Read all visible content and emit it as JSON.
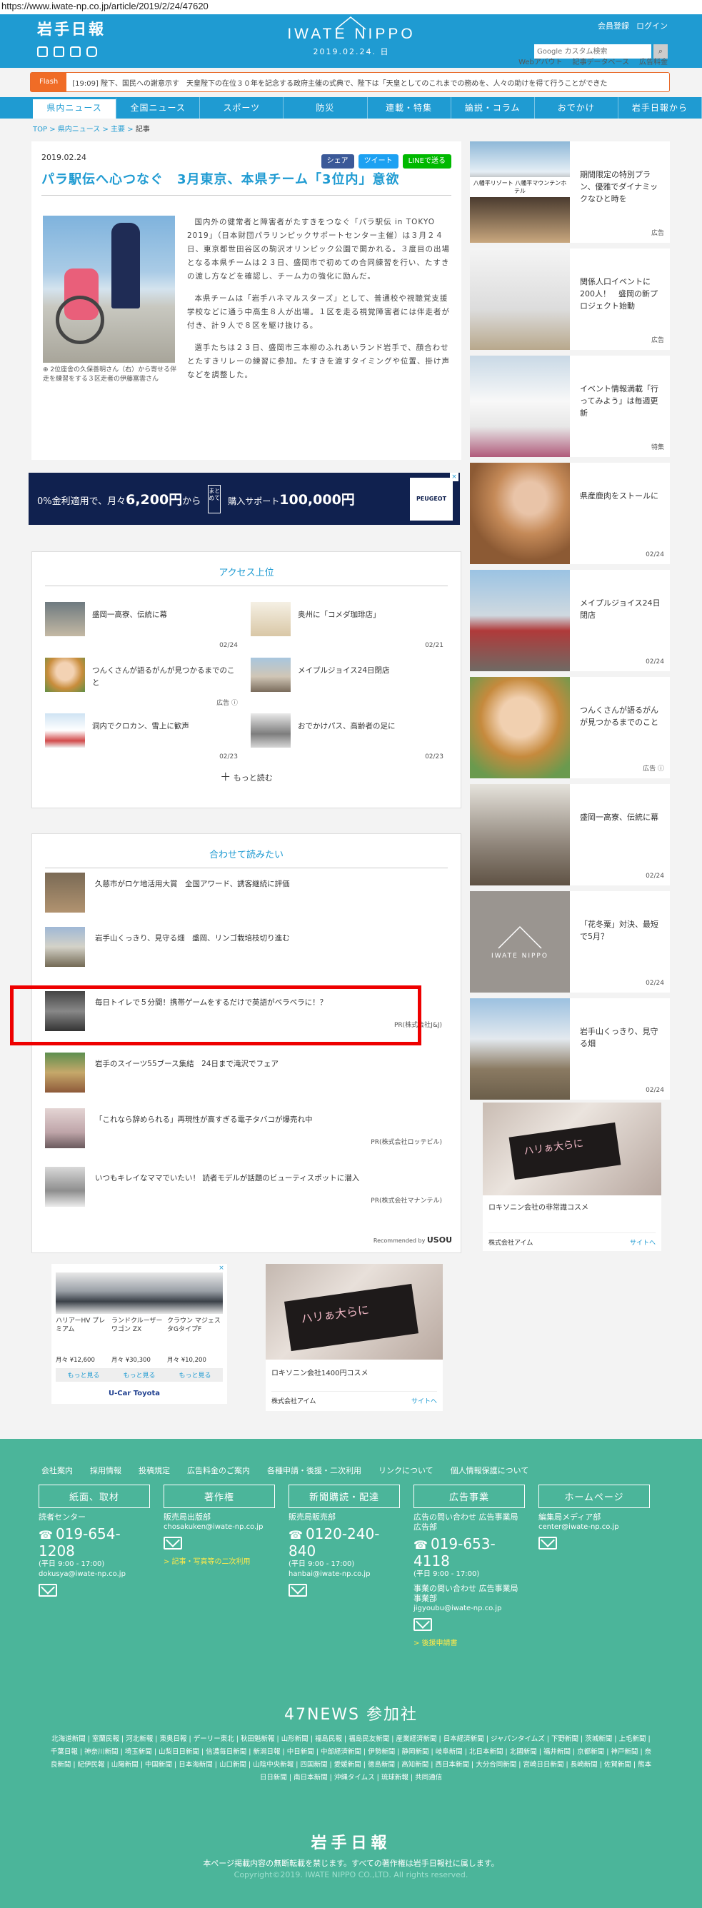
{
  "url": "https://www.iwate-np.co.jp/article/2019/2/24/47620",
  "header": {
    "brand": "岩手日報",
    "logo": "IWATE NIPPO",
    "date": "2019.02.24. 日",
    "account": [
      "会員登録",
      "ログイン"
    ],
    "search_placeholder": "Google カスタム検索",
    "subnav": [
      "Webアバウト",
      "記事データベース",
      "広告料金"
    ]
  },
  "flash": {
    "tag": "Flash",
    "time": "[19:09]",
    "headline": "陛下、国民への謝意示す",
    "text": "天皇陛下の在位３０年を記念する政府主催の式典で、陛下は「天皇としてのこれまでの務めを、人々の助けを得て行うことができた"
  },
  "nav": [
    "県内ニュース",
    "全国ニュース",
    "スポーツ",
    "防災",
    "連載・特集",
    "論説・コラム",
    "おでかけ",
    "岩手日報から"
  ],
  "breadcrumb": {
    "top": "TOP",
    "sep": ">",
    "cat": "県内ニュース",
    "sub": "主要",
    "cur": "記事"
  },
  "article": {
    "date": "2019.02.24",
    "share": [
      "シェア",
      "ツイート",
      "LINEで送る"
    ],
    "title": "パラ駅伝へ心つなぐ　3月東京、本県チーム「3位内」意欲",
    "caption": "2位座舎の久保善明さん（右）から寄せる伴走を練習をする３区走者の伊藤富雲さん",
    "paragraphs": [
      "国内外の健常者と障害者がたすきをつなぐ「パラ駅伝 in TOKYO 2019」（日本財団パラリンピックサポートセンター主催）は３月２４日、東京都世田谷区の駒沢オリンピック公園で開かれる。３度目の出場となる本県チームは２３日、盛岡市で初めての合同練習を行い、たすきの渡し方などを確認し、チーム力の強化に励んだ。",
      "本県チームは「岩手ハネマルスターズ」として、普通校や視聴覚支援学校などに通う中高生８人が出場。１区を走る視覚障害者には伴走者が付き、計９人で８区を駆け抜ける。",
      "選手たちは２３日、盛岡市三本柳のふれあいランド岩手で、顔合わせとたすきリレーの練習に参加。たすきを渡すタイミングや位置、掛け声などを調整した。"
    ]
  },
  "banner1": {
    "a": "0%金利適用で、月々",
    "b": "6,200円",
    "c": "から",
    "box": "購入サポート",
    "d": "100,000円",
    "brand": "PEUGEOT"
  },
  "ranking": {
    "title": "アクセス上位",
    "items": [
      {
        "text": "盛岡一高寮、伝統に幕",
        "date": "02/24"
      },
      {
        "text": "奥州に「コメダ珈琲店」",
        "date": "02/21"
      },
      {
        "text": "つんくさんが語るがんが見つかるまでのこと",
        "date": "広告 ⓘ"
      },
      {
        "text": "メイプルジョイス24日閉店",
        "date": ""
      },
      {
        "text": "洞内でクロカン、雪上に歓声",
        "date": "02/23"
      },
      {
        "text": "おでかけパス、高齢者の足に",
        "date": "02/23"
      }
    ],
    "more": "もっと読む"
  },
  "related": {
    "title": "合わせて読みたい",
    "items": [
      {
        "text": "久慈市がロケ地活用大賞　全国アワード、誘客継続に評価",
        "pr": ""
      },
      {
        "text": "岩手山くっきり、見守る畑　盛岡、リンゴ栽培枝切り進む",
        "pr": ""
      },
      {
        "text": "毎日トイレで５分間！携帯ゲームをするだけで英語がペラペラに！？",
        "pr": "PR(株式会社J&J)"
      },
      {
        "text": "岩手のスイーツ55ブース集結　24日まで滝沢でフェア",
        "pr": ""
      },
      {
        "text": "「これなら辞められる」再現性が高すぎる電子タバコが爆売れ中",
        "pr": "PR(株式会社ロッテビル)"
      },
      {
        "text": "いつもキレイなママでいたい！ 読者モデルが話題のビューティスポットに潜入",
        "pr": "PR(株式会社マナンテル)"
      }
    ],
    "rec": "Recommended by",
    "rec_brand": "USOU"
  },
  "ad_cars": {
    "items": [
      {
        "name": "ハリアーHV プレミアム",
        "price": "月々 ¥12,600"
      },
      {
        "name": "ランドクルーザーワゴン ZX",
        "price": "月々 ¥30,300"
      },
      {
        "name": "クラウン マジェスタGタイプF",
        "price": "月々 ¥10,200"
      }
    ],
    "btn": "もっと見る",
    "brand": "U-Car Toyota"
  },
  "ad_cosme": {
    "pkg": "ハリぁ大らに",
    "text": "ロキソニン会社1400円コスメ",
    "company": "株式会社アイム",
    "site": "サイトへ"
  },
  "sidebar": [
    {
      "text": "期間限定の特別プラン、優雅でダイナミックなひと時を",
      "date": "広告",
      "img": "八幡平リゾート 八幡平マウンテンホテル"
    },
    {
      "text": "関係人口イベントに200人！　盛岡の新プロジェクト始動",
      "date": "広告"
    },
    {
      "text": "イベント情報満載「行ってみよう」は毎週更新",
      "date": "特集"
    },
    {
      "text": "県産鹿肉をストールに",
      "date": "02/24"
    },
    {
      "text": "メイプルジョイス24日閉店",
      "date": "02/24"
    },
    {
      "text": "つんくさんが語るがんが見つかるまでのこと",
      "date": "広告 ⓘ"
    },
    {
      "text": "盛岡一高寮、伝統に幕",
      "date": "02/24"
    },
    {
      "text": "「花冬粟」対決、最短で5月？",
      "date": "02/24",
      "img": "IWATE NIPPO"
    },
    {
      "text": "岩手山くっきり、見守る畑",
      "date": "02/24"
    }
  ],
  "side_ad": {
    "pkg": "ハリぁ大らに",
    "text": "ロキソニン会社の非常識コスメ",
    "company": "株式会社アイム",
    "site": "サイトへ"
  },
  "footer": {
    "links": [
      "会社案内",
      "採用情報",
      "投稿規定",
      "広告料金のご案内",
      "各種申請・後援・二次利用",
      "リンクについて",
      "個人情報保護について"
    ],
    "cols": [
      {
        "head": "紙面、取材",
        "label": "読者センター",
        "tel": "019-654-1208",
        "hours": "(平日 9:00 - 17:00)",
        "mail": "dokusya@iwate-np.co.jp",
        "extra": ""
      },
      {
        "head": "著作権",
        "label": "販売局出版部",
        "tel": "",
        "hours": "",
        "mail": "chosakuken@iwate-np.co.jp",
        "extra": "> 記事・写真等の二次利用"
      },
      {
        "head": "新聞購読・配達",
        "label": "販売局販売部",
        "tel": "0120-240-840",
        "hours": "(平日 9:00 - 17:00)",
        "mail": "hanbai@iwate-np.co.jp",
        "extra": ""
      },
      {
        "head": "広告事業",
        "label": "広告の問い合わせ 広告事業局広告部",
        "tel": "019-653-4118",
        "hours": "(平日 9:00 - 17:00)",
        "mail": "",
        "label2": "事業の問い合わせ 広告事業局事業部",
        "mail2": "jigyoubu@iwate-np.co.jp",
        "extra": "> 後援申請書"
      },
      {
        "head": "ホームページ",
        "label": "編集局メディア部",
        "tel": "",
        "hours": "",
        "mail": "center@iwate-np.co.jp",
        "extra": ""
      }
    ],
    "news_title": "47NEWS 参加社",
    "news_list": "北海道新聞 | 室蘭民報 | 河北新報 | 東奥日報 | デーリー東北 | 秋田魁新報 | 山形新聞 | 福島民報 | 福島民友新聞 | 産業経済新聞 | 日本経済新聞 | ジャパンタイムズ | 下野新聞 | 茨城新聞 | 上毛新聞 | 千葉日報 | 神奈川新聞 | 埼玉新聞 | 山梨日日新聞 | 信濃毎日新聞 | 新潟日報 | 中日新聞 | 中部経済新聞 | 伊勢新聞 | 静岡新聞 | 岐阜新聞 | 北日本新聞 | 北國新聞 | 福井新聞 | 京都新聞 | 神戸新聞 | 奈良新聞 | 紀伊民報 | 山陽新聞 | 中国新聞 | 日本海新聞 | 山口新聞 | 山陰中央新報 | 四国新聞 | 愛媛新聞 | 徳島新聞 | 高知新聞 | 西日本新聞 | 大分合同新聞 | 宮崎日日新聞 | 長崎新聞 | 佐賀新聞 | 熊本日日新聞 | 南日本新聞 | 沖縄タイムス | 琉球新報 | 共同通信",
    "brand": "岩手日報",
    "note": "本ページ掲載内容の無断転載を禁じます。すべての著作権は岩手日報社に属します。",
    "copy": "Copyright©2019. IWATE NIPPO CO.,LTD. All rights reserved."
  }
}
